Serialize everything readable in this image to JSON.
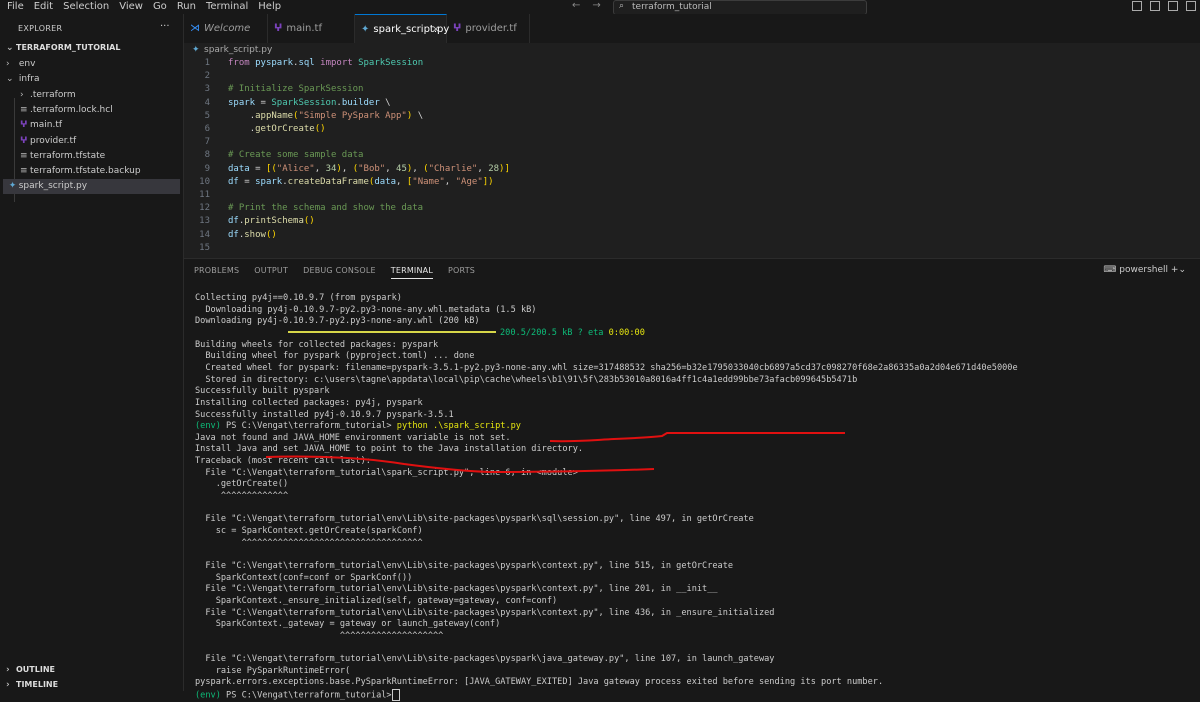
{
  "menubar": {
    "items": [
      "File",
      "Edit",
      "Selection",
      "View",
      "Go",
      "Run",
      "Terminal",
      "Help"
    ]
  },
  "search": {
    "text": "terraform_tutorial"
  },
  "explorer": {
    "header": "EXPLORER",
    "root": "TERRAFORM_TUTORIAL",
    "items": [
      {
        "label": "env",
        "kind": "folder-collapsed"
      },
      {
        "label": "infra",
        "kind": "folder-open"
      },
      {
        "label": ".terraform",
        "kind": "folder-collapsed"
      },
      {
        "label": ".terraform.lock.hcl",
        "kind": "file"
      },
      {
        "label": "main.tf",
        "kind": "tf"
      },
      {
        "label": "provider.tf",
        "kind": "tf"
      },
      {
        "label": "terraform.tfstate",
        "kind": "file"
      },
      {
        "label": "terraform.tfstate.backup",
        "kind": "file"
      },
      {
        "label": "spark_script.py",
        "kind": "py"
      }
    ],
    "outline": "OUTLINE",
    "timeline": "TIMELINE"
  },
  "tabs": [
    {
      "label": "Welcome",
      "active": false
    },
    {
      "label": "main.tf",
      "active": false
    },
    {
      "label": "spark_script.py",
      "active": true
    },
    {
      "label": "provider.tf",
      "active": false
    }
  ],
  "breadcrumb": "spark_script.py",
  "code_lines": [
    "from pyspark.sql import SparkSession",
    "",
    "# Initialize SparkSession",
    "spark = SparkSession.builder \\",
    "    .appName(\"Simple PySpark App\") \\",
    "    .getOrCreate()",
    "",
    "# Create some sample data",
    "data = [(\"Alice\", 34), (\"Bob\", 45), (\"Charlie\", 28)]",
    "df = spark.createDataFrame(data, [\"Name\", \"Age\"])",
    "",
    "# Print the schema and show the data",
    "df.printSchema()",
    "df.show()",
    ""
  ],
  "panel": {
    "tabs": [
      "PROBLEMS",
      "OUTPUT",
      "DEBUG CONSOLE",
      "TERMINAL",
      "PORTS"
    ],
    "active_tab": "TERMINAL",
    "shell": "powershell"
  },
  "terminal": {
    "lines": [
      "Collecting py4j==0.10.9.7 (from pyspark)",
      "  Downloading py4j-0.10.9.7-py2.py3-none-any.whl.metadata (1.5 kB)",
      "Downloading py4j-0.10.9.7-py2.py3-none-any.whl (200 kB)",
      "",
      "Building wheels for collected packages: pyspark",
      "  Building wheel for pyspark (pyproject.toml) ... done",
      "  Created wheel for pyspark: filename=pyspark-3.5.1-py2.py3-none-any.whl size=317488532 sha256=b32e1795033040cb6897a5cd37c098270f68e2a86335a0a2d04e671d40e5000e",
      "  Stored in directory: c:\\users\\tagne\\appdata\\local\\pip\\cache\\wheels\\b1\\91\\5f\\283b53010a8016a4ff1c4a1edd99bbe73afacb099645b5471b",
      "Successfully built pyspark",
      "Installing collected packages: py4j, pyspark",
      "Successfully installed py4j-0.10.9.7 pyspark-3.5.1",
      "",
      "Java not found and JAVA_HOME environment variable is not set.",
      "Install Java and set JAVA_HOME to point to the Java installation directory.",
      "Traceback (most recent call last):",
      "  File \"C:\\Vengat\\terraform_tutorial\\spark_script.py\", line 6, in <module>",
      "    .getOrCreate()",
      "     ^^^^^^^^^^^^^",
      "",
      "  File \"C:\\Vengat\\terraform_tutorial\\env\\Lib\\site-packages\\pyspark\\sql\\session.py\", line 497, in getOrCreate",
      "    sc = SparkContext.getOrCreate(sparkConf)",
      "         ^^^^^^^^^^^^^^^^^^^^^^^^^^^^^^^^^^^",
      "",
      "  File \"C:\\Vengat\\terraform_tutorial\\env\\Lib\\site-packages\\pyspark\\context.py\", line 515, in getOrCreate",
      "    SparkContext(conf=conf or SparkConf())",
      "  File \"C:\\Vengat\\terraform_tutorial\\env\\Lib\\site-packages\\pyspark\\context.py\", line 201, in __init__",
      "    SparkContext._ensure_initialized(self, gateway=gateway, conf=conf)",
      "  File \"C:\\Vengat\\terraform_tutorial\\env\\Lib\\site-packages\\pyspark\\context.py\", line 436, in _ensure_initialized",
      "    SparkContext._gateway = gateway or launch_gateway(conf)",
      "                            ^^^^^^^^^^^^^^^^^^^^",
      "",
      "  File \"C:\\Vengat\\terraform_tutorial\\env\\Lib\\site-packages\\pyspark\\java_gateway.py\", line 107, in launch_gateway",
      "    raise PySparkRuntimeError(",
      "pyspark.errors.exceptions.base.PySparkRuntimeError: [JAVA_GATEWAY_EXITED] Java gateway process exited before sending its port number."
    ],
    "progress": {
      "text": "200.5/200.5 kB ? eta",
      "time": "0:00:00",
      "fraction": 1.0
    },
    "prompt_env": "(env)",
    "prompt_path": "PS C:\\Vengat\\terraform_tutorial>",
    "command": "python .\\spark_script.py"
  }
}
